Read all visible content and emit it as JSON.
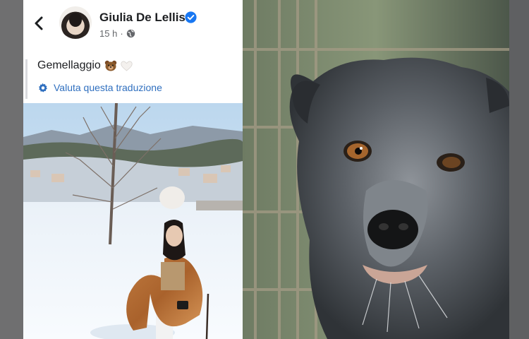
{
  "header": {
    "author_name": "Giulia De Lellis",
    "time": "15 h",
    "separator": "·"
  },
  "caption": {
    "text": "Gemellaggio",
    "emojis": [
      "bear-emoji",
      "white-heart-emoji"
    ]
  },
  "translation": {
    "link_label": "Valuta questa traduzione"
  },
  "colors": {
    "verified": "#1877f2",
    "link": "#2f6fbf",
    "name": "#1c1e21",
    "meta": "#65676b"
  },
  "icons": [
    "back-arrow-icon",
    "verified-badge-icon",
    "globe-icon",
    "gear-icon"
  ]
}
